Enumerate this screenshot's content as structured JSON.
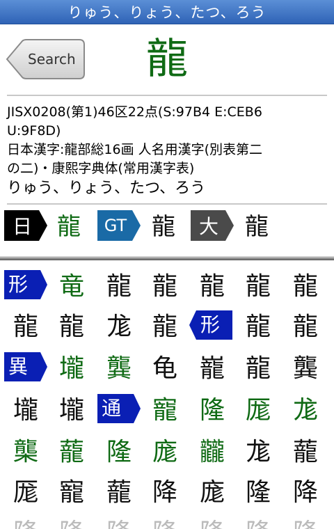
{
  "header": {
    "title": "りゅう、りょう、たつ、ろう"
  },
  "search_button": {
    "label": "Search"
  },
  "kanji": {
    "character": "龍"
  },
  "info": {
    "code_line1": "JISX0208(第1)46区22点(S:97B4 E:CEB6",
    "code_line2": "U:9F8D)",
    "desc_line1": "日本漢字:龍部総16画 人名用漢字(別表第二",
    "desc_line2": "の二)・康熙字典体(常用漢字表)",
    "reading": "りゅう、りょう、たつ、ろう"
  },
  "font_variants": [
    {
      "tag": "日",
      "tag_color": "#000000",
      "char": "龍",
      "char_color": "#0f6a14"
    },
    {
      "tag": "GT",
      "tag_color": "#1a6aa6",
      "char": "龍",
      "char_color": "#111111"
    },
    {
      "tag": "大",
      "tag_color": "#4a4a4a",
      "char": "龍",
      "char_color": "#111111"
    }
  ],
  "variant_badges": {
    "form": "形",
    "variant": "異",
    "common": "通"
  },
  "colors": {
    "badge_blue": "#0a1fb4",
    "green": "#0f6a14",
    "title_bar": "#2f63b6"
  },
  "grid": [
    [
      "",
      "竜",
      "龍",
      "龍",
      "龍",
      "龍",
      "龍"
    ],
    [
      "龍",
      "龍",
      "尨",
      "龍",
      "",
      "龍",
      "龍"
    ],
    [
      "",
      "壠",
      "龔",
      "龟",
      "巃",
      "龍",
      "龔"
    ],
    [
      "壠",
      "壠",
      "",
      "寵",
      "隆",
      "厖",
      "尨"
    ],
    [
      "㰍",
      "蘢",
      "隆",
      "庬",
      "龖",
      "尨",
      "蘢"
    ],
    [
      "厖",
      "寵",
      "蘢",
      "降",
      "庬",
      "隆",
      "降"
    ],
    [
      "隆",
      "隆",
      "隆",
      "隆",
      "隆",
      "隆",
      "隆"
    ]
  ]
}
